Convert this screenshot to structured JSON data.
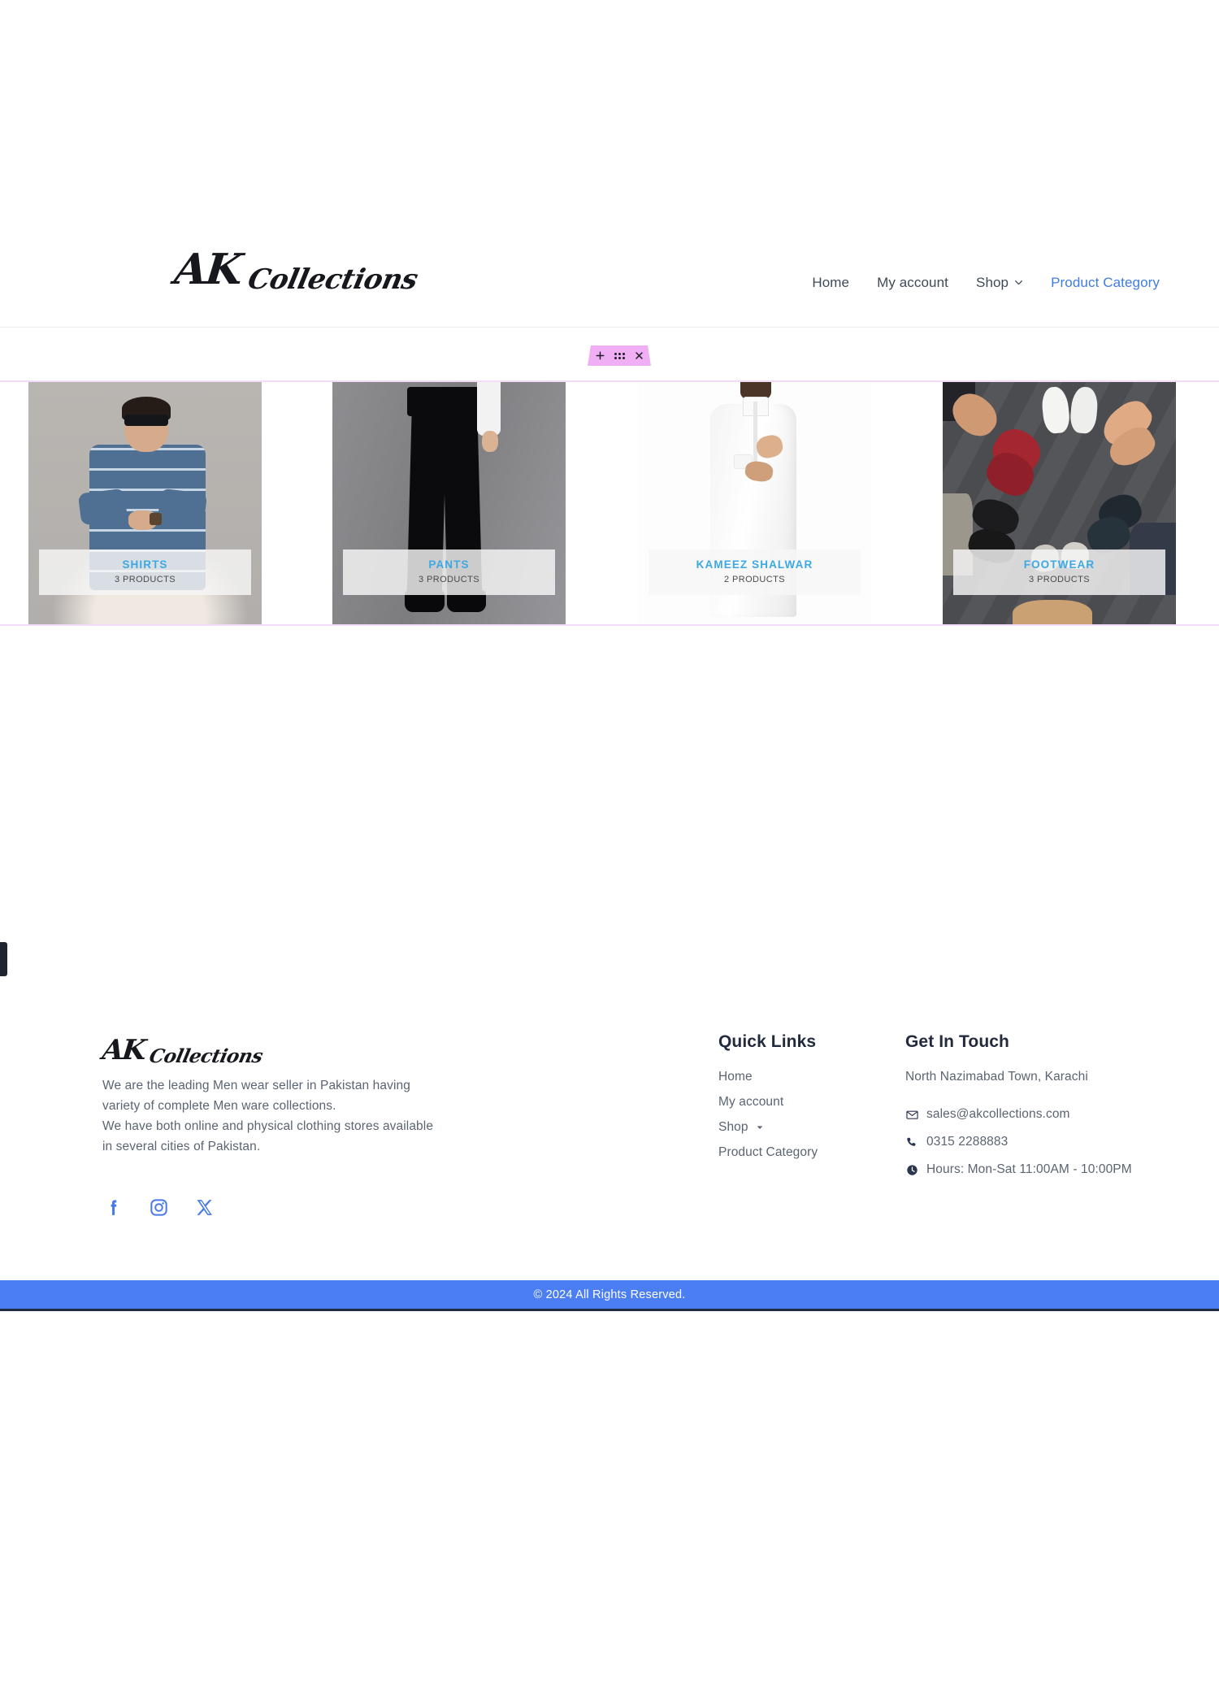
{
  "brand": {
    "part1": "AK",
    "part2": "Collections"
  },
  "nav": {
    "items": [
      {
        "label": "Home",
        "active": false,
        "caret": false
      },
      {
        "label": "My account",
        "active": false,
        "caret": false
      },
      {
        "label": "Shop",
        "active": false,
        "caret": true
      },
      {
        "label": "Product Category",
        "active": true,
        "caret": false
      }
    ]
  },
  "element_toolbar": {
    "add_label": "+",
    "drag_label": "drag-handle",
    "close_label": "✕",
    "color": "#f0aef5"
  },
  "categories": [
    {
      "title": "SHIRTS",
      "count": "3 PRODUCTS",
      "image": "man-in-blue-plaid-shirt"
    },
    {
      "title": "PANTS",
      "count": "3 PRODUCTS",
      "image": "black-formal-trousers"
    },
    {
      "title": "KAMEEZ SHALWAR",
      "count": "2 PRODUCTS",
      "image": "man-in-white-kameez-shalwar"
    },
    {
      "title": "FOOTWEAR",
      "count": "3 PRODUCTS",
      "image": "circle-of-feet-and-shoes"
    }
  ],
  "footer": {
    "about": {
      "line1": "We are the leading Men wear seller in Pakistan having variety of complete Men ware collections.",
      "line2": "We have both online and physical clothing stores available in several cities of Pakistan."
    },
    "social": [
      {
        "name": "facebook",
        "label": "Facebook"
      },
      {
        "name": "instagram",
        "label": "Instagram"
      },
      {
        "name": "x-twitter",
        "label": "X"
      }
    ],
    "quick_links": {
      "heading": "Quick Links",
      "items": [
        {
          "label": "Home",
          "caret": false
        },
        {
          "label": "My account",
          "caret": false
        },
        {
          "label": "Shop",
          "caret": true
        },
        {
          "label": "Product Category",
          "caret": false
        }
      ]
    },
    "get_in_touch": {
      "heading": "Get In Touch",
      "address": "North Nazimabad Town, Karachi",
      "email": "sales@akcollections.com",
      "phone": "0315 2288883",
      "hours": "Hours: Mon-Sat 11:00AM - 10:00PM"
    },
    "copyright": "© 2024 All Rights Reserved."
  },
  "colors": {
    "accent_blue": "#4a7ef2",
    "category_title": "#3ca8e4",
    "link_active": "#3f7de0",
    "toolbar_pink": "#f0aef5",
    "footer_heading": "#222a3d"
  }
}
